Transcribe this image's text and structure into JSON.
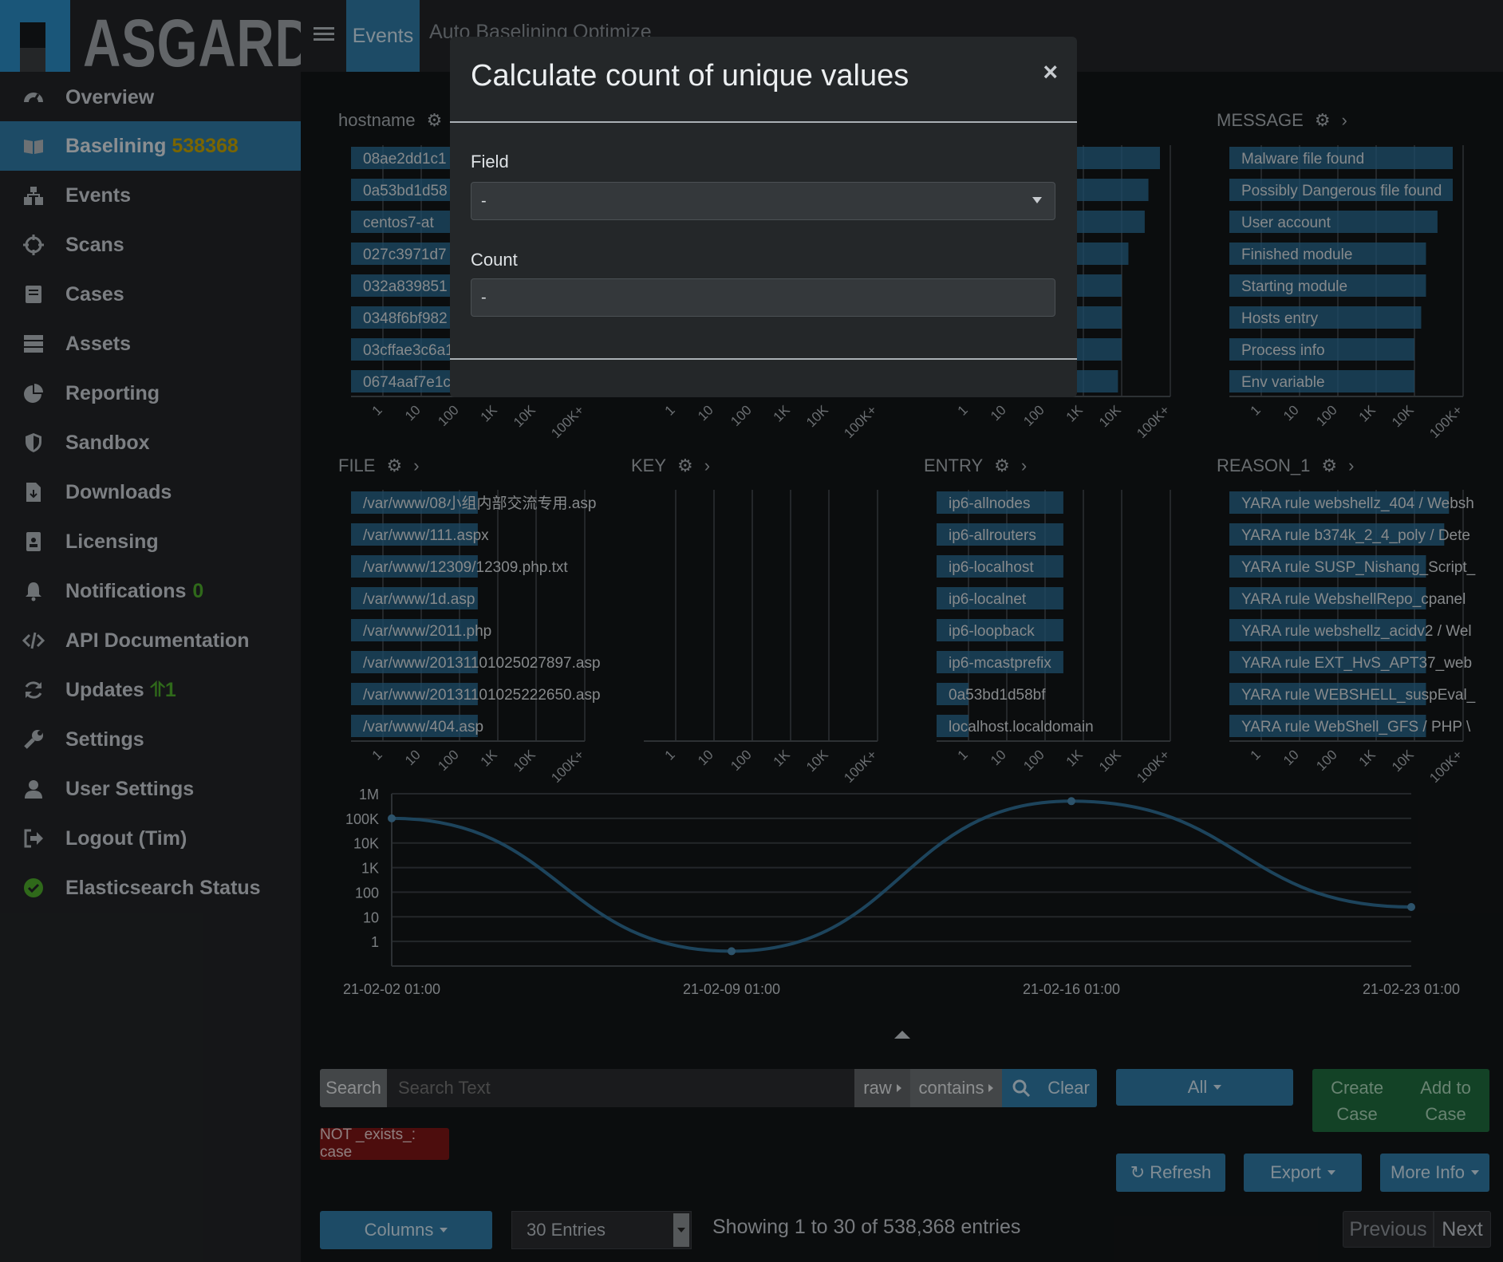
{
  "app": {
    "name": "ASGARD"
  },
  "topnav": {
    "tabs": [
      "Events",
      "Auto Baselining",
      "Optimize"
    ]
  },
  "sidebar": {
    "items": [
      {
        "label": "Overview",
        "icon": "tachometer-icon"
      },
      {
        "label": "Baselining",
        "badge": "538368",
        "icon": "book-icon"
      },
      {
        "label": "Events",
        "icon": "sitemap-icon"
      },
      {
        "label": "Scans",
        "icon": "crosshairs-icon"
      },
      {
        "label": "Cases",
        "icon": "case-icon"
      },
      {
        "label": "Assets",
        "icon": "server-icon"
      },
      {
        "label": "Reporting",
        "icon": "pie-chart-icon"
      },
      {
        "label": "Sandbox",
        "icon": "shield-icon"
      },
      {
        "label": "Downloads",
        "icon": "file-download-icon"
      },
      {
        "label": "Licensing",
        "icon": "id-badge-icon"
      },
      {
        "label": "Notifications",
        "badge": "0",
        "icon": "bell-icon"
      },
      {
        "label": "API Documentation",
        "icon": "code-icon"
      },
      {
        "label": "Updates",
        "badge": "1",
        "icon": "sync-icon"
      },
      {
        "label": "Settings",
        "icon": "wrench-icon"
      },
      {
        "label": "User Settings",
        "icon": "user-icon"
      },
      {
        "label": "Logout (Tim)",
        "icon": "sign-out-icon"
      },
      {
        "label": "Elasticsearch Status",
        "icon": "check-circle-icon"
      }
    ]
  },
  "panels": [
    {
      "title": "hostname",
      "rows": [
        {
          "label": "08ae2dd1c1",
          "value": 100000
        },
        {
          "label": "0a53bd1d58",
          "value": 50000
        },
        {
          "label": "centos7-at",
          "value": 40000
        },
        {
          "label": "027c3971d7",
          "value": 15000
        },
        {
          "label": "032a839851",
          "value": 10000
        },
        {
          "label": "0348f6bf982",
          "value": 10000
        },
        {
          "label": "03cffae3c6a1",
          "value": 10000
        },
        {
          "label": "0674aaf7e1c",
          "value": 8000
        }
      ]
    },
    {
      "title": "",
      "rows": [
        {
          "label": "",
          "value": 100000
        },
        {
          "label": "",
          "value": 50000
        },
        {
          "label": "",
          "value": 40000
        },
        {
          "label": "",
          "value": 15000
        },
        {
          "label": "",
          "value": 10000
        },
        {
          "label": "",
          "value": 10000
        },
        {
          "label": "",
          "value": 10000
        },
        {
          "label": "",
          "value": 8000
        }
      ]
    },
    {
      "title": "",
      "rows": [
        {
          "label": "",
          "value": 100000
        },
        {
          "label": "",
          "value": 50000
        },
        {
          "label": "",
          "value": 40000
        },
        {
          "label": "",
          "value": 15000
        },
        {
          "label": "",
          "value": 10000
        },
        {
          "label": "",
          "value": 10000
        },
        {
          "label": "",
          "value": 10000
        },
        {
          "label": "",
          "value": 8000
        }
      ]
    },
    {
      "title": "MESSAGE",
      "rows": [
        {
          "label": "Malware file found",
          "value": 100000
        },
        {
          "label": "Possibly Dangerous file found",
          "value": 100000
        },
        {
          "label": "User account",
          "value": 40000
        },
        {
          "label": "Finished module",
          "value": 20000
        },
        {
          "label": "Starting module",
          "value": 20000
        },
        {
          "label": "Hosts entry",
          "value": 15000
        },
        {
          "label": "Process info",
          "value": 10000
        },
        {
          "label": "Env variable",
          "value": 10000
        }
      ]
    },
    {
      "title": "FILE",
      "rows": [
        {
          "label": "/var/www/08小组内部交流专用.asp",
          "value": 300
        },
        {
          "label": "/var/www/111.aspx",
          "value": 300
        },
        {
          "label": "/var/www/12309/12309.php.txt",
          "value": 300
        },
        {
          "label": "/var/www/1d.asp",
          "value": 300
        },
        {
          "label": "/var/www/2011.php",
          "value": 300
        },
        {
          "label": "/var/www/20131101025027897.asp",
          "value": 300
        },
        {
          "label": "/var/www/20131101025222650.asp",
          "value": 300
        },
        {
          "label": "/var/www/404.asp",
          "value": 300
        }
      ]
    },
    {
      "title": "KEY",
      "rows": []
    },
    {
      "title": "ENTRY",
      "rows": [
        {
          "label": "ip6-allnodes",
          "value": 300
        },
        {
          "label": "ip6-allrouters",
          "value": 300
        },
        {
          "label": "ip6-localhost",
          "value": 300
        },
        {
          "label": "ip6-localnet",
          "value": 300
        },
        {
          "label": "ip6-loopback",
          "value": 300
        },
        {
          "label": "ip6-mcastprefix",
          "value": 300
        },
        {
          "label": "0a53bd1d58bf",
          "value": 1
        },
        {
          "label": "localhost.localdomain",
          "value": 1
        }
      ]
    },
    {
      "title": "REASON_1",
      "rows": [
        {
          "label": "YARA rule webshellz_404 / Websh",
          "value": 80000
        },
        {
          "label": "YARA rule b374k_2_4_poly / Dete",
          "value": 60000
        },
        {
          "label": "YARA rule SUSP_Nishang_Script_",
          "value": 20000
        },
        {
          "label": "YARA rule WebshellRepo_cpanel",
          "value": 20000
        },
        {
          "label": "YARA rule webshellz_acidv2 / Wel",
          "value": 20000
        },
        {
          "label": "YARA rule EXT_HvS_APT37_web",
          "value": 20000
        },
        {
          "label": "YARA rule WEBSHELL_suspEval_",
          "value": 20000
        },
        {
          "label": "YARA rule WebShell_GFS / PHP \\",
          "value": 20000
        }
      ]
    }
  ],
  "panel_axis_ticks": [
    "1",
    "10",
    "100",
    "1K",
    "10K",
    "100K+"
  ],
  "chart_data": {
    "type": "line",
    "scale": "log",
    "ytick_labels": [
      "1M",
      "100K",
      "10K",
      "1K",
      "100",
      "10",
      "1"
    ],
    "xtick_labels": [
      "21-02-02 01:00",
      "21-02-09 01:00",
      "21-02-16 01:00",
      "21-02-23 01:00"
    ],
    "x": [
      "2021-02-02",
      "2021-02-09",
      "2021-02-16",
      "2021-02-23"
    ],
    "y": [
      100000,
      0.4,
      500000,
      25
    ],
    "color": "#2f6f95"
  },
  "search": {
    "label": "Search",
    "placeholder": "Search Text",
    "mode": "raw",
    "operator": "contains",
    "clear_label": "Clear",
    "all_label": "All",
    "filter_tag": "NOT _exists_: case"
  },
  "actions": {
    "create_case": [
      "Create",
      "Case"
    ],
    "add_to_case": [
      "Add to",
      "Case"
    ],
    "refresh": "Refresh",
    "export": "Export",
    "more_info": "More Info",
    "columns": "Columns",
    "entries": "30 Entries",
    "showing": "Showing 1 to 30 of 538,368 entries",
    "previous": "Previous",
    "next": "Next"
  },
  "modal": {
    "title": "Calculate count of unique values",
    "close": "×",
    "field_label": "Field",
    "field_value": "-",
    "count_label": "Count",
    "count_value": "-"
  },
  "colors": {
    "accent": "#2f7aa5",
    "green": "#1f6b3e",
    "danger": "#7d1616",
    "badge_yellow": "#c5a300",
    "badge_green": "#4caa2b"
  }
}
